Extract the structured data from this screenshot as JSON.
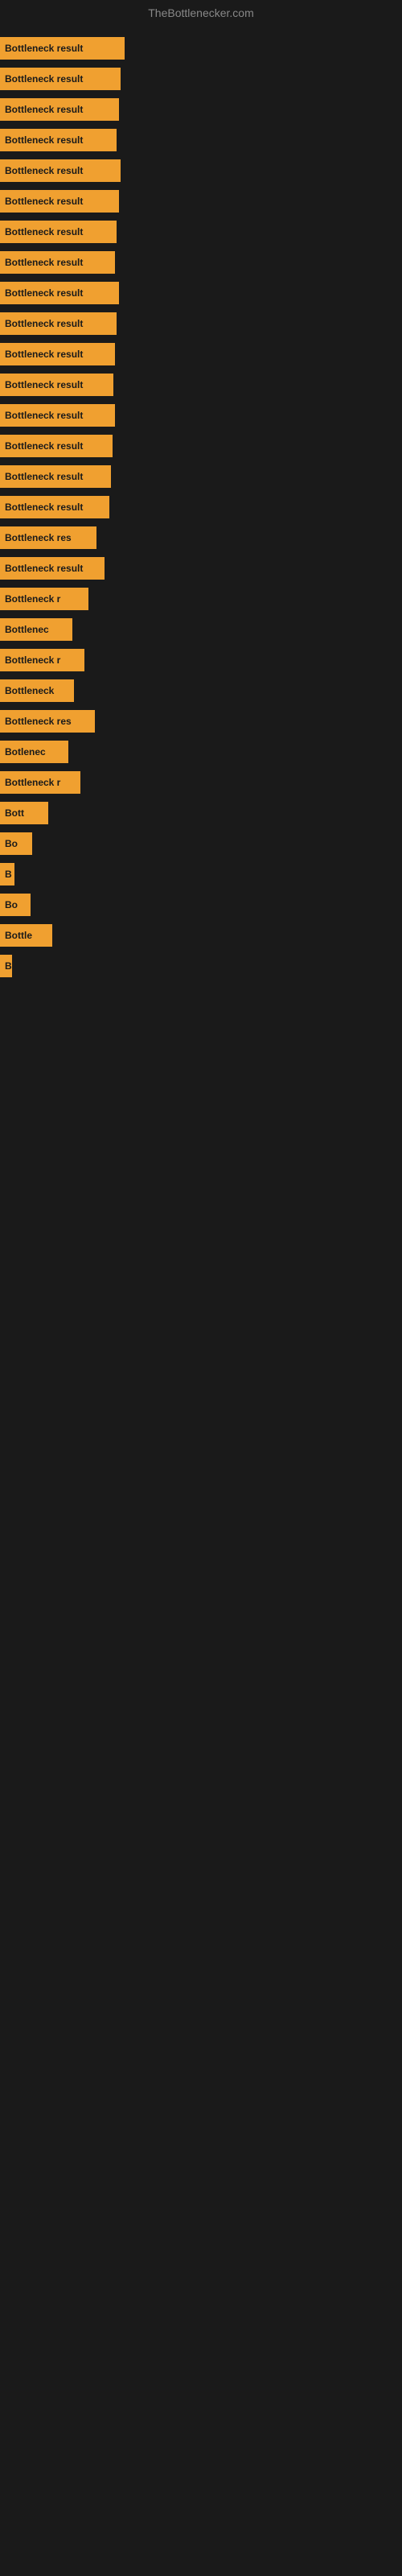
{
  "header": {
    "title": "TheBottlenecker.com"
  },
  "bars": [
    {
      "label": "Bottleneck result",
      "width": 155
    },
    {
      "label": "Bottleneck result",
      "width": 150
    },
    {
      "label": "Bottleneck result",
      "width": 148
    },
    {
      "label": "Bottleneck result",
      "width": 145
    },
    {
      "label": "Bottleneck result",
      "width": 150
    },
    {
      "label": "Bottleneck result",
      "width": 148
    },
    {
      "label": "Bottleneck result",
      "width": 145
    },
    {
      "label": "Bottleneck result",
      "width": 143
    },
    {
      "label": "Bottleneck result",
      "width": 148
    },
    {
      "label": "Bottleneck result",
      "width": 145
    },
    {
      "label": "Bottleneck result",
      "width": 143
    },
    {
      "label": "Bottleneck result",
      "width": 141
    },
    {
      "label": "Bottleneck result",
      "width": 143
    },
    {
      "label": "Bottleneck result",
      "width": 140
    },
    {
      "label": "Bottleneck result",
      "width": 138
    },
    {
      "label": "Bottleneck result",
      "width": 136
    },
    {
      "label": "Bottleneck res",
      "width": 120
    },
    {
      "label": "Bottleneck result",
      "width": 130
    },
    {
      "label": "Bottleneck r",
      "width": 110
    },
    {
      "label": "Bottlenec",
      "width": 90
    },
    {
      "label": "Bottleneck r",
      "width": 105
    },
    {
      "label": "Bottleneck",
      "width": 92
    },
    {
      "label": "Bottleneck res",
      "width": 118
    },
    {
      "label": "Botlenec",
      "width": 85
    },
    {
      "label": "Bottleneck r",
      "width": 100
    },
    {
      "label": "Bott",
      "width": 60
    },
    {
      "label": "Bo",
      "width": 40
    },
    {
      "label": "B",
      "width": 18
    },
    {
      "label": "Bo",
      "width": 38
    },
    {
      "label": "Bottle",
      "width": 65
    },
    {
      "label": "B",
      "width": 15
    },
    {
      "label": "",
      "width": 0
    },
    {
      "label": "",
      "width": 0
    },
    {
      "label": "",
      "width": 0
    },
    {
      "label": "",
      "width": 0
    },
    {
      "label": "",
      "width": 0
    },
    {
      "label": "",
      "width": 0
    },
    {
      "label": "",
      "width": 0
    },
    {
      "label": "",
      "width": 0
    },
    {
      "label": "",
      "width": 0
    },
    {
      "label": "",
      "width": 0
    },
    {
      "label": "",
      "width": 0
    },
    {
      "label": "",
      "width": 0
    },
    {
      "label": "",
      "width": 0
    },
    {
      "label": "",
      "width": 0
    },
    {
      "label": "",
      "width": 0
    },
    {
      "label": "",
      "width": 0
    },
    {
      "label": "",
      "width": 0
    },
    {
      "label": "",
      "width": 0
    },
    {
      "label": "",
      "width": 0
    },
    {
      "label": "",
      "width": 0
    }
  ]
}
